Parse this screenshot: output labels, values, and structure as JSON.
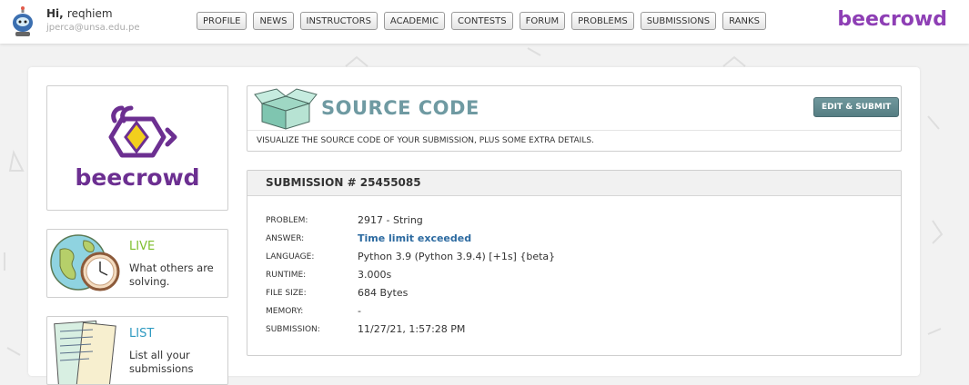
{
  "user": {
    "greeting": "Hi,",
    "username": "reqhiem",
    "email": "jperca@unsa.edu.pe"
  },
  "nav": [
    "PROFILE",
    "NEWS",
    "INSTRUCTORS",
    "ACADEMIC",
    "CONTESTS",
    "FORUM",
    "PROBLEMS",
    "SUBMISSIONS",
    "RANKS"
  ],
  "brand": "beecrowd",
  "logo_text": "beecrowd",
  "sidebar": [
    {
      "title": "LIVE",
      "desc": "What others are solving.",
      "color": "#7fbf2e"
    },
    {
      "title": "LIST",
      "desc": "List all your submissions",
      "color": "#2e9ac1"
    }
  ],
  "source": {
    "title": "SOURCE CODE",
    "button": "EDIT & SUBMIT",
    "subtitle": "VISUALIZE THE SOURCE CODE OF YOUR SUBMISSION, PLUS SOME EXTRA DETAILS."
  },
  "submission": {
    "header": "SUBMISSION # 25455085",
    "fields": [
      {
        "label": "PROBLEM:",
        "value": "2917 - String"
      },
      {
        "label": "ANSWER:",
        "value": "Time limit exceeded"
      },
      {
        "label": "LANGUAGE:",
        "value": "Python 3.9 (Python 3.9.4) [+1s] {beta}"
      },
      {
        "label": "RUNTIME:",
        "value": "3.000s"
      },
      {
        "label": "FILE SIZE:",
        "value": "684 Bytes"
      },
      {
        "label": "MEMORY:",
        "value": "-"
      },
      {
        "label": "SUBMISSION:",
        "value": "11/27/21, 1:57:28 PM"
      }
    ]
  },
  "colors": {
    "brand_purple": "#8e3fb5",
    "logo_purple": "#6c2f91",
    "logo_yellow": "#f2cf1d",
    "answer_blue": "#2c6aa0",
    "title_teal": "#6f9aa2"
  },
  "icons": {
    "avatar": "robot-avatar-icon",
    "live": "globe-clock-icon",
    "list": "paper-list-icon",
    "source": "open-box-icon"
  }
}
